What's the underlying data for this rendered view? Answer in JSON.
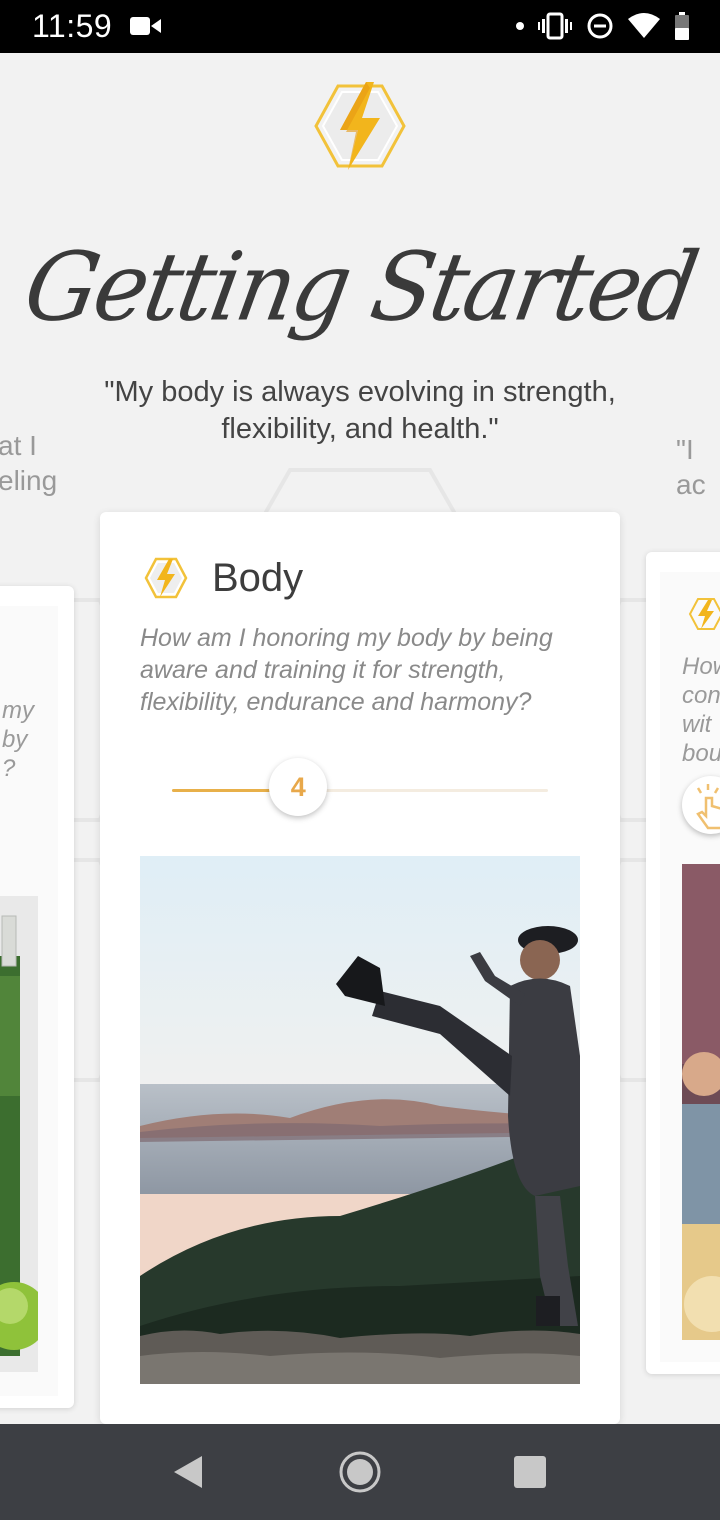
{
  "status_bar": {
    "time": "11:59",
    "icons": [
      "video-camera-icon",
      "notification-dot-icon",
      "vibrate-icon",
      "do-not-disturb-icon",
      "wifi-icon",
      "battery-icon"
    ]
  },
  "header": {
    "logo_icon": "lightning-hexagon-logo",
    "title": "Getting Started",
    "quote": "\"My body is always evolving in strength, flexibility, and health.\""
  },
  "side_text": {
    "left_line1": "at I",
    "left_line2": "eling",
    "right_line1": "\"I ac"
  },
  "left_card": {
    "question_fragment_1": "my",
    "question_fragment_2": "by",
    "question_fragment_3": "?"
  },
  "main_card": {
    "icon": "lightning-hexagon-icon",
    "title": "Body",
    "question": "How am I honoring my body by being aware and training it for strength, flexibility, endurance and harmony?",
    "slider_value": "4",
    "slider_fraction": 0.32,
    "photo_description": "person-kicking-on-mountain-photo"
  },
  "right_card": {
    "question_fragment_1": "How",
    "question_fragment_2": "con",
    "question_fragment_3": "wit",
    "question_fragment_4": "bou",
    "slider_icon": "tap-hand-icon"
  },
  "nav_bar": {
    "back": "back-icon",
    "home": "home-icon",
    "recents": "recents-icon"
  },
  "colors": {
    "accent": "#e8b04a",
    "bolt": "#f2b51c",
    "text_dark": "#3d3d3d",
    "text_muted": "#8a8a8a"
  }
}
